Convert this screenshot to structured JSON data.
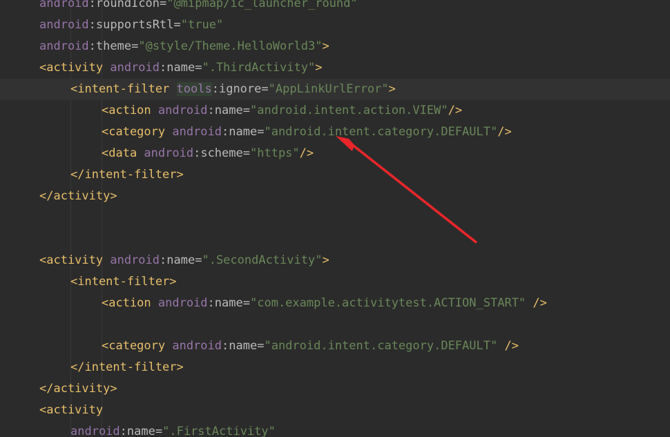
{
  "editor": {
    "lines": [
      {
        "indent": 1,
        "tokens": [
          {
            "t": "ns",
            "v": "android"
          },
          {
            "t": "pun",
            "v": ":"
          },
          {
            "t": "attr",
            "v": "roundIcon"
          },
          {
            "t": "pun",
            "v": "="
          },
          {
            "t": "val",
            "v": "\"@mipmap/ic_launcher_round\""
          }
        ]
      },
      {
        "indent": 1,
        "tokens": [
          {
            "t": "ns",
            "v": "android"
          },
          {
            "t": "pun",
            "v": ":"
          },
          {
            "t": "attr",
            "v": "supportsRtl"
          },
          {
            "t": "pun",
            "v": "="
          },
          {
            "t": "val",
            "v": "\"true\""
          }
        ]
      },
      {
        "indent": 1,
        "tokens": [
          {
            "t": "ns",
            "v": "android"
          },
          {
            "t": "pun",
            "v": ":"
          },
          {
            "t": "attr",
            "v": "theme"
          },
          {
            "t": "pun",
            "v": "="
          },
          {
            "t": "val",
            "v": "\"@style/Theme.HelloWorld3\""
          },
          {
            "t": "tag",
            "v": ">"
          }
        ]
      },
      {
        "indent": 1,
        "tokens": [
          {
            "t": "tag",
            "v": "<activity "
          },
          {
            "t": "ns",
            "v": "android"
          },
          {
            "t": "pun",
            "v": ":"
          },
          {
            "t": "attr",
            "v": "name"
          },
          {
            "t": "pun",
            "v": "="
          },
          {
            "t": "val",
            "v": "\".ThirdActivity\""
          },
          {
            "t": "tag",
            "v": ">"
          }
        ]
      },
      {
        "indent": 2,
        "current": true,
        "tokens": [
          {
            "t": "tag",
            "v": "<intent-filter "
          },
          {
            "t": "ns hl-tools",
            "v": "tools"
          },
          {
            "t": "pun",
            "v": ":"
          },
          {
            "t": "attr",
            "v": "ignore"
          },
          {
            "t": "pun",
            "v": "="
          },
          {
            "t": "val",
            "v": "\"AppLinkUrlError\""
          },
          {
            "t": "tag",
            "v": ">"
          }
        ]
      },
      {
        "indent": 3,
        "tokens": [
          {
            "t": "tag",
            "v": "<action "
          },
          {
            "t": "ns",
            "v": "android"
          },
          {
            "t": "pun",
            "v": ":"
          },
          {
            "t": "attr",
            "v": "name"
          },
          {
            "t": "pun",
            "v": "="
          },
          {
            "t": "val",
            "v": "\"android.intent.action.VIEW\""
          },
          {
            "t": "tag",
            "v": "/>"
          }
        ]
      },
      {
        "indent": 3,
        "tokens": [
          {
            "t": "tag",
            "v": "<category "
          },
          {
            "t": "ns",
            "v": "android"
          },
          {
            "t": "pun",
            "v": ":"
          },
          {
            "t": "attr",
            "v": "name"
          },
          {
            "t": "pun",
            "v": "="
          },
          {
            "t": "val",
            "v": "\"android.intent.category.DEFAULT\""
          },
          {
            "t": "tag",
            "v": "/>"
          }
        ]
      },
      {
        "indent": 3,
        "tokens": [
          {
            "t": "tag",
            "v": "<data "
          },
          {
            "t": "ns",
            "v": "android"
          },
          {
            "t": "pun",
            "v": ":"
          },
          {
            "t": "attr",
            "v": "scheme"
          },
          {
            "t": "pun",
            "v": "="
          },
          {
            "t": "val",
            "v": "\"https\""
          },
          {
            "t": "tag",
            "v": "/>"
          }
        ]
      },
      {
        "indent": 2,
        "tokens": [
          {
            "t": "tag",
            "v": "</intent-filter>"
          }
        ]
      },
      {
        "indent": 1,
        "tokens": [
          {
            "t": "tag",
            "v": "</activity>"
          }
        ]
      },
      {
        "indent": 0,
        "tokens": []
      },
      {
        "indent": 0,
        "tokens": []
      },
      {
        "indent": 1,
        "tokens": [
          {
            "t": "tag",
            "v": "<activity "
          },
          {
            "t": "ns",
            "v": "android"
          },
          {
            "t": "pun",
            "v": ":"
          },
          {
            "t": "attr",
            "v": "name"
          },
          {
            "t": "pun",
            "v": "="
          },
          {
            "t": "val",
            "v": "\".SecondActivity\""
          },
          {
            "t": "tag",
            "v": ">"
          }
        ]
      },
      {
        "indent": 2,
        "tokens": [
          {
            "t": "tag",
            "v": "<intent-filter>"
          }
        ]
      },
      {
        "indent": 3,
        "tokens": [
          {
            "t": "tag",
            "v": "<action "
          },
          {
            "t": "ns",
            "v": "android"
          },
          {
            "t": "pun",
            "v": ":"
          },
          {
            "t": "attr",
            "v": "name"
          },
          {
            "t": "pun",
            "v": "="
          },
          {
            "t": "val",
            "v": "\"com.example.activitytest.ACTION_START\""
          },
          {
            "t": "tag",
            "v": " />"
          }
        ]
      },
      {
        "indent": 0,
        "tokens": []
      },
      {
        "indent": 3,
        "tokens": [
          {
            "t": "tag",
            "v": "<category "
          },
          {
            "t": "ns",
            "v": "android"
          },
          {
            "t": "pun",
            "v": ":"
          },
          {
            "t": "attr",
            "v": "name"
          },
          {
            "t": "pun",
            "v": "="
          },
          {
            "t": "val",
            "v": "\"android.intent.category.DEFAULT\""
          },
          {
            "t": "tag",
            "v": " />"
          }
        ]
      },
      {
        "indent": 2,
        "tokens": [
          {
            "t": "tag",
            "v": "</intent-filter>"
          }
        ]
      },
      {
        "indent": 1,
        "tokens": [
          {
            "t": "tag",
            "v": "</activity>"
          }
        ]
      },
      {
        "indent": 1,
        "tokens": [
          {
            "t": "tag",
            "v": "<activity"
          }
        ]
      },
      {
        "indent": 2,
        "tokens": [
          {
            "t": "ns",
            "v": "android"
          },
          {
            "t": "pun",
            "v": ":"
          },
          {
            "t": "attr",
            "v": "name"
          },
          {
            "t": "pun",
            "v": "="
          },
          {
            "t": "val",
            "v": "\".FirstActivity\""
          }
        ]
      }
    ]
  },
  "colors": {
    "background": "#2b2b2b",
    "current_line": "#323232",
    "tag": "#e8bf6a",
    "namespace": "#9876aa",
    "attribute": "#bababa",
    "value": "#6a8759",
    "annotation_arrow": "#e8262a"
  },
  "annotation": {
    "type": "arrow",
    "points_to": "android.intent.category.DEFAULT"
  }
}
